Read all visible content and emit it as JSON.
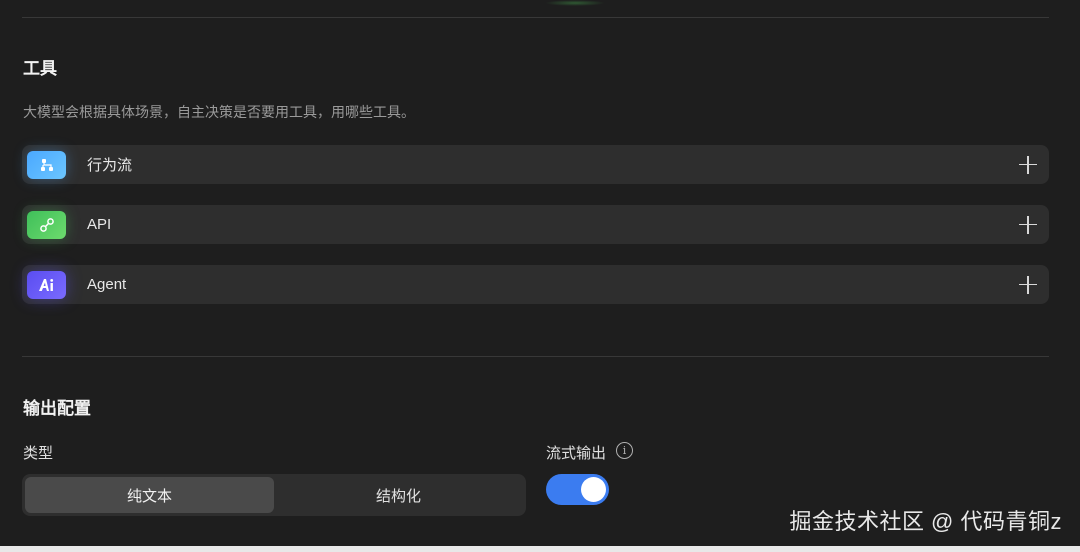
{
  "tools_section": {
    "title": "工具",
    "description": "大模型会根据具体场景，自主决策是否要用工具，用哪些工具。",
    "items": [
      {
        "label": "行为流",
        "icon": "workflow-icon"
      },
      {
        "label": "API",
        "icon": "link-icon"
      },
      {
        "label": "Agent",
        "icon": "ai-icon"
      }
    ],
    "add_icon": "plus-icon"
  },
  "output_section": {
    "title": "输出配置",
    "type_label": "类型",
    "type_options": [
      "纯文本",
      "结构化"
    ],
    "selected_type": "纯文本",
    "stream_label": "流式输出",
    "stream_enabled": true
  },
  "watermark": "掘金技术社区 @ 代码青铜z",
  "colors": {
    "background": "#1e1e1e",
    "row": "#2e2e2e",
    "toggle_on": "#3b7cf0",
    "flow_icon": "#4aa8ff",
    "api_icon": "#3fbf5a",
    "agent_icon": "#5a4df0"
  }
}
